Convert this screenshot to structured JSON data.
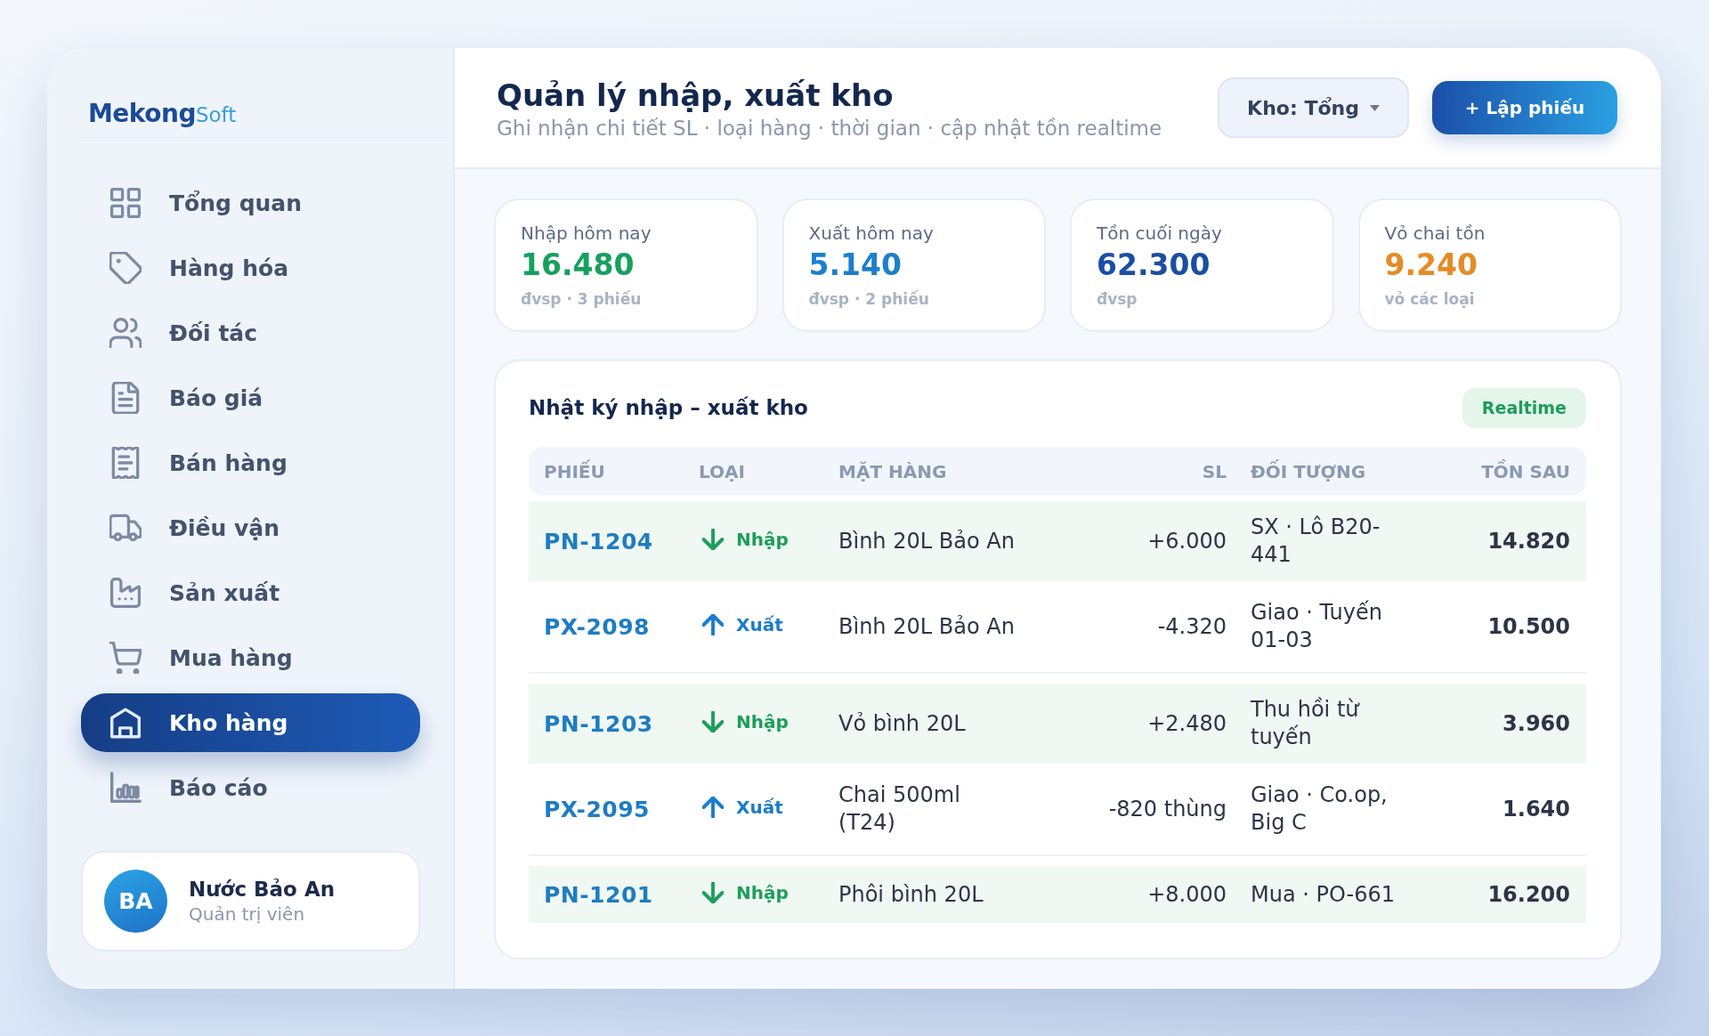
{
  "logo": {
    "primary": "Mekong",
    "secondary": "Soft"
  },
  "sidebar": {
    "items": [
      {
        "label": "Tổng quan",
        "selected": false
      },
      {
        "label": "Hàng hóa",
        "selected": false
      },
      {
        "label": "Đối tác",
        "selected": false
      },
      {
        "label": "Báo giá",
        "selected": false
      },
      {
        "label": "Bán hàng",
        "selected": false
      },
      {
        "label": "Điều vận",
        "selected": false
      },
      {
        "label": "Sản xuất",
        "selected": false
      },
      {
        "label": "Mua hàng",
        "selected": false
      },
      {
        "label": "Kho hàng",
        "selected": true
      },
      {
        "label": "Báo cáo",
        "selected": false
      }
    ],
    "user": {
      "initials": "BA",
      "name": "Nước Bảo An",
      "role": "Quản trị viên"
    }
  },
  "header": {
    "title": "Quản lý nhập, xuất kho",
    "subtitle": "Ghi nhận chi tiết SL · loại hàng · thời gian · cập nhật tồn realtime",
    "warehouse_select": {
      "value": "Kho: Tổng"
    },
    "create_button": "+ Lập phiếu"
  },
  "stats": [
    {
      "label": "Nhập hôm nay",
      "value": "16.480",
      "note": "đvsp · 3 phiếu",
      "color": "#17a05d"
    },
    {
      "label": "Xuất hôm nay",
      "value": "5.140",
      "note": "đvsp · 2 phiếu",
      "color": "#1c7fcc"
    },
    {
      "label": "Tồn cuối ngày",
      "value": "62.300",
      "note": "đvsp",
      "color": "#1b4ea3"
    },
    {
      "label": "Vỏ chai tồn",
      "value": "9.240",
      "note": "vỏ các loại",
      "color": "#e58b25"
    }
  ],
  "log": {
    "title": "Nhật ký nhập – xuất kho",
    "badge": "Realtime",
    "table": {
      "columns": [
        "PHIẾU",
        "LOẠI",
        "MẶT HÀNG",
        "SL",
        "ĐỐI TƯỢNG",
        "TỒN SAU"
      ],
      "rows": [
        {
          "code": "PN-1204",
          "kind": "in",
          "type": "Nhập",
          "item": "Bình 20L Bảo An",
          "qty": "+6.000",
          "party": "SX · Lô B20-441",
          "balance": "14.820"
        },
        {
          "code": "PX-2098",
          "kind": "out",
          "type": "Xuất",
          "item": "Bình 20L Bảo An",
          "qty": "-4.320",
          "party": "Giao · Tuyến 01-03",
          "balance": "10.500"
        },
        {
          "code": "PN-1203",
          "kind": "in",
          "type": "Nhập",
          "item": "Vỏ bình 20L",
          "qty": "+2.480",
          "party": "Thu hồi từ tuyến",
          "balance": "3.960"
        },
        {
          "code": "PX-2095",
          "kind": "out",
          "type": "Xuất",
          "item": "Chai 500ml (T24)",
          "qty": "-820 thùng",
          "party": "Giao · Co.op, Big C",
          "balance": "1.640"
        },
        {
          "code": "PN-1201",
          "kind": "in",
          "type": "Nhập",
          "item": "Phôi bình 20L",
          "qty": "+8.000",
          "party": "Mua · PO-661",
          "balance": "16.200"
        }
      ]
    }
  }
}
